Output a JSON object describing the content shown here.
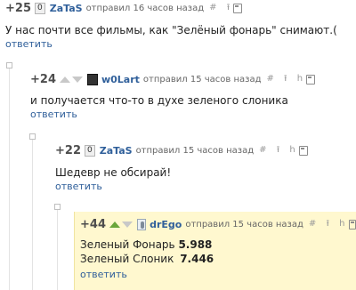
{
  "comments": [
    {
      "score": "+25",
      "badge": "0",
      "avatar": "zero-badge",
      "user": "ZaTaS",
      "meta": "отправил 16 часов назад",
      "icons_text": "# ⭱",
      "text": "У нас почти все фильмы, как \"Зелёный фонарь\" снимают.(",
      "reply": "ответить"
    },
    {
      "score": "+24",
      "user": "w0Lart",
      "meta": "отправил 15 часов назад",
      "icons_text": "# ⭱ h",
      "text": "и получается что-то в духе зеленого слоника",
      "reply": "ответить"
    },
    {
      "score": "+22",
      "badge": "0",
      "user": "ZaTaS",
      "meta": "отправил 15 часов назад",
      "icons_text": "# ⭱ h",
      "text": "Шедевр не обсирай!",
      "reply": "ответить"
    },
    {
      "score": "+44",
      "user": "drEgo",
      "meta": "отправил 15 часов назад",
      "icons_text": "# ⭱ h",
      "line1_label": "Зеленый Фонарь",
      "line1_value": "5.988",
      "line2_label": "Зеленый Слоник",
      "line2_value": "7.446",
      "reply": "ответить"
    }
  ],
  "colors": {
    "link": "#2f5f9a",
    "highlight": "#fff8cf",
    "upvote_active": "#6aa63a"
  }
}
